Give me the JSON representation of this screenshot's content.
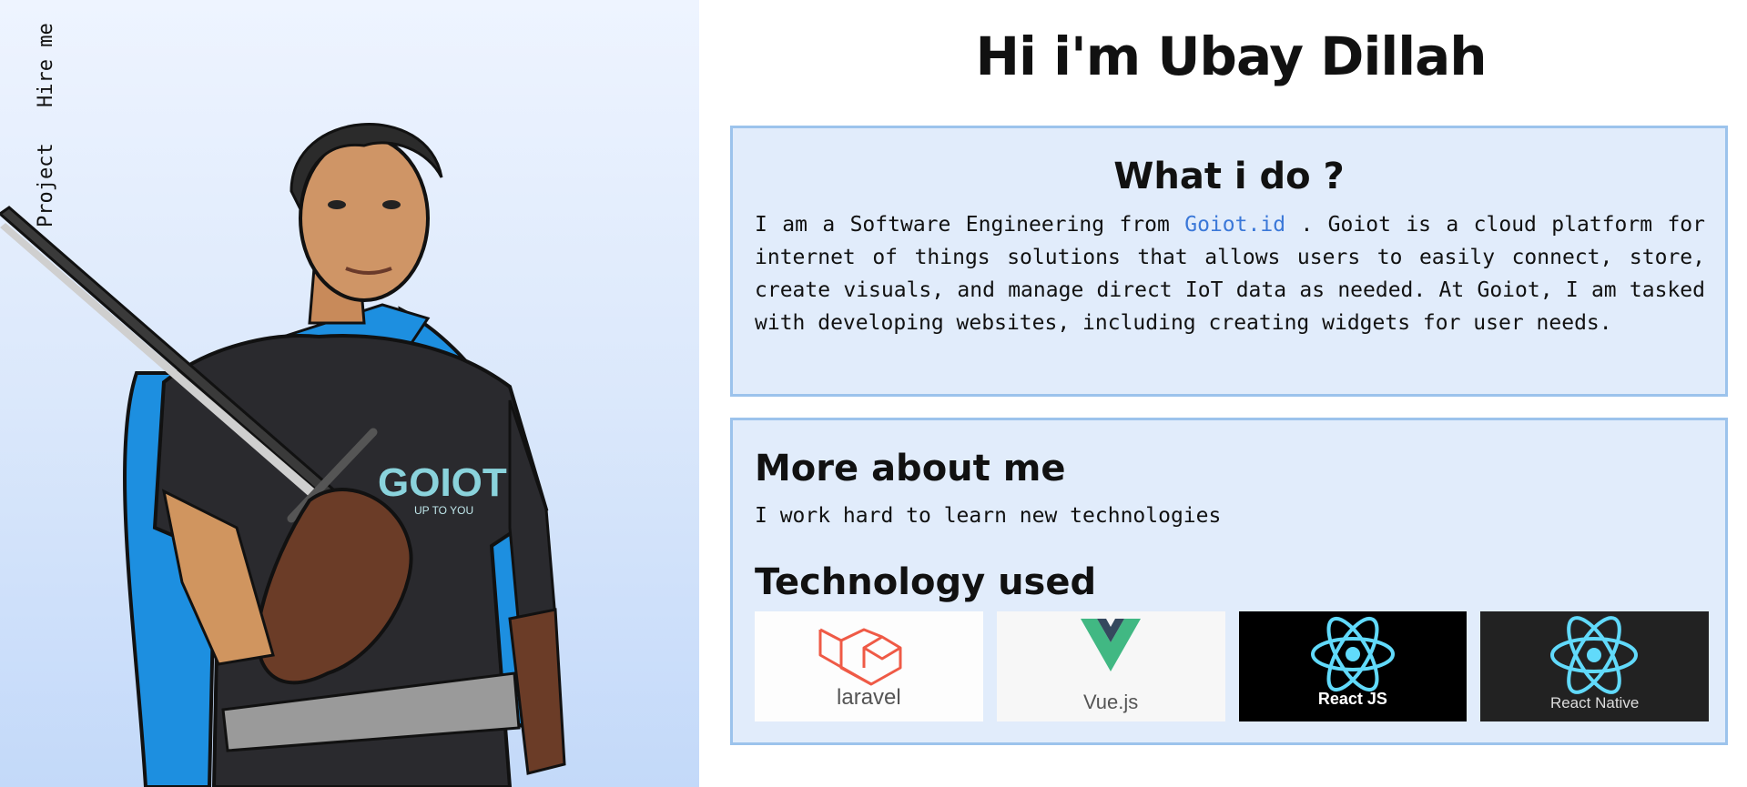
{
  "nav": {
    "hire_label": "Hire me",
    "project_label": "Project"
  },
  "portrait": {
    "shirt_text": "GOIOT",
    "shirt_tagline": "UP TO YOU"
  },
  "hero": {
    "title": "Hi i'm Ubay Dillah"
  },
  "what": {
    "title": "What i do ?",
    "text_before_link": "I am a Software Engineering from ",
    "link_text": "Goiot.id",
    "text_after_link": " . Goiot is a cloud platform for internet of things solutions that allows users to easily connect, store, create visuals, and manage direct IoT data as needed. At Goiot, I am tasked with developing websites, including creating widgets for user needs."
  },
  "more": {
    "title": "More about me",
    "text": "I work hard to learn new technologies",
    "tech_title": "Technology used",
    "technologies": [
      {
        "label": "laravel",
        "icon": "laravel-logo",
        "bg": "#fdfdfd"
      },
      {
        "label": "Vue.js",
        "icon": "vue-logo",
        "bg": "#f7f7f7"
      },
      {
        "label": "React JS",
        "icon": "react-logo",
        "bg": "#000000"
      },
      {
        "label": "React Native",
        "icon": "react-logo",
        "bg": "#222222"
      }
    ]
  },
  "colors": {
    "accent_link": "#3b78d8",
    "card_bg": "#e1ecfb",
    "card_border": "#9cc3ec",
    "react_cyan": "#61dafb",
    "laravel_red": "#ef5a46",
    "vue_green": "#41b883",
    "vue_dark": "#35495e"
  }
}
